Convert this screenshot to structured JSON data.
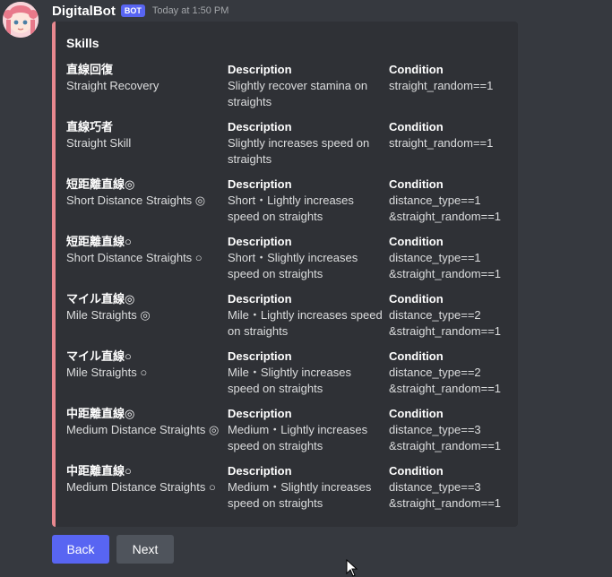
{
  "message": {
    "username": "DigitalBot",
    "bot_tag": "BOT",
    "timestamp": "Today at 1:50 PM"
  },
  "embed": {
    "accent_color": "#e8888f",
    "title": "Skills",
    "skills": [
      {
        "name": "直線回復",
        "name_en": "Straight Recovery",
        "desc_label": "Description",
        "desc": "Slightly recover stamina on straights",
        "cond_label": "Condition",
        "cond": "straight_random==1"
      },
      {
        "name": "直線巧者",
        "name_en": "Straight Skill",
        "desc_label": "Description",
        "desc": "Slightly increases speed on straights",
        "cond_label": "Condition",
        "cond": "straight_random==1"
      },
      {
        "name": "短距離直線◎",
        "name_en": "Short Distance Straights ◎",
        "desc_label": "Description",
        "desc": "Short・Lightly increases speed on straights",
        "cond_label": "Condition",
        "cond": "distance_type==1 &straight_random==1"
      },
      {
        "name": "短距離直線○",
        "name_en": "Short Distance Straights ○",
        "desc_label": "Description",
        "desc": "Short・Slightly increases speed on straights",
        "cond_label": "Condition",
        "cond": "distance_type==1 &straight_random==1"
      },
      {
        "name": "マイル直線◎",
        "name_en": "Mile Straights ◎",
        "desc_label": "Description",
        "desc": "Mile・Lightly increases speed on straights",
        "cond_label": "Condition",
        "cond": "distance_type==2 &straight_random==1"
      },
      {
        "name": "マイル直線○",
        "name_en": "Mile Straights ○",
        "desc_label": "Description",
        "desc": "Mile・Slightly increases speed on straights",
        "cond_label": "Condition",
        "cond": "distance_type==2 &straight_random==1"
      },
      {
        "name": "中距離直線◎",
        "name_en": "Medium Distance Straights ◎",
        "desc_label": "Description",
        "desc": "Medium・Lightly increases speed on straights",
        "cond_label": "Condition",
        "cond": "distance_type==3 &straight_random==1"
      },
      {
        "name": "中距離直線○",
        "name_en": "Medium Distance Straights ○",
        "desc_label": "Description",
        "desc": "Medium・Slightly increases speed on straights",
        "cond_label": "Condition",
        "cond": "distance_type==3 &straight_random==1"
      }
    ]
  },
  "buttons": {
    "back_label": "Back",
    "next_label": "Next"
  },
  "colors": {
    "background": "#36393f",
    "embed_bg": "#2f3136",
    "blurple": "#5865f2",
    "secondary": "#4f545c"
  }
}
